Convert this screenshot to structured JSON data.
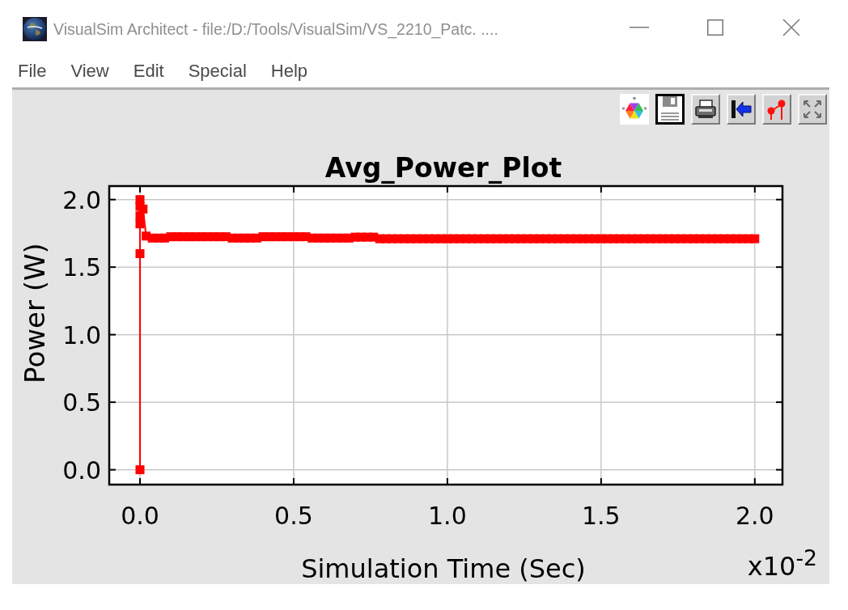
{
  "window": {
    "title": "VisualSim Architect - file:/D:/Tools/VisualSim/VS_2210_Patc. ...."
  },
  "menu": [
    "File",
    "View",
    "Edit",
    "Special",
    "Help"
  ],
  "plot": {
    "chart_data": {
      "type": "line",
      "title": "Avg_Power_Plot",
      "xlabel": "Simulation Time (Sec)",
      "ylabel": "Power (W)",
      "x": [
        0,
        0,
        0,
        0,
        0,
        0,
        0.01,
        0.02,
        0.04,
        0.06,
        0.08,
        0.1,
        0.12,
        0.14,
        0.16,
        0.18,
        0.2,
        0.22,
        0.24,
        0.26,
        0.28,
        0.3,
        0.32,
        0.34,
        0.36,
        0.38,
        0.4,
        0.42,
        0.44,
        0.46,
        0.48,
        0.5,
        0.52,
        0.54,
        0.56,
        0.58,
        0.6,
        0.62,
        0.64,
        0.66,
        0.68,
        0.7,
        0.72,
        0.74,
        0.76,
        0.78,
        0.8,
        0.82,
        0.84,
        0.86,
        0.88,
        0.9,
        0.92,
        0.94,
        0.96,
        0.98,
        1.0,
        1.02,
        1.04,
        1.06,
        1.08,
        1.1,
        1.12,
        1.14,
        1.16,
        1.18,
        1.2,
        1.22,
        1.24,
        1.26,
        1.28,
        1.3,
        1.32,
        1.34,
        1.36,
        1.38,
        1.4,
        1.42,
        1.44,
        1.46,
        1.48,
        1.5,
        1.52,
        1.54,
        1.56,
        1.58,
        1.6,
        1.62,
        1.64,
        1.66,
        1.68,
        1.7,
        1.72,
        1.74,
        1.76,
        1.78,
        1.8,
        1.82,
        1.84,
        1.86,
        1.88,
        1.9,
        1.92,
        1.94,
        1.96,
        1.98,
        2.0
      ],
      "series": [
        {
          "color": "#ff0000",
          "marker": "square",
          "values": [
            0,
            1.6,
            2.0,
            1.95,
            1.88,
            1.82,
            1.93,
            1.73,
            1.715,
            1.715,
            1.715,
            1.725,
            1.725,
            1.725,
            1.725,
            1.725,
            1.725,
            1.725,
            1.725,
            1.725,
            1.725,
            1.715,
            1.715,
            1.715,
            1.715,
            1.715,
            1.725,
            1.725,
            1.725,
            1.725,
            1.725,
            1.725,
            1.725,
            1.725,
            1.715,
            1.715,
            1.715,
            1.715,
            1.715,
            1.715,
            1.715,
            1.722,
            1.722,
            1.722,
            1.722,
            1.71,
            1.71,
            1.71,
            1.71,
            1.71,
            1.71,
            1.71,
            1.71,
            1.71,
            1.71,
            1.71,
            1.71,
            1.71,
            1.71,
            1.71,
            1.71,
            1.71,
            1.71,
            1.71,
            1.71,
            1.71,
            1.71,
            1.71,
            1.71,
            1.71,
            1.71,
            1.71,
            1.71,
            1.71,
            1.71,
            1.71,
            1.71,
            1.71,
            1.71,
            1.71,
            1.71,
            1.71,
            1.71,
            1.71,
            1.71,
            1.71,
            1.71,
            1.71,
            1.71,
            1.71,
            1.71,
            1.71,
            1.71,
            1.71,
            1.71,
            1.71,
            1.71,
            1.71,
            1.71,
            1.71,
            1.71,
            1.71,
            1.71,
            1.71,
            1.71,
            1.71,
            1.71
          ]
        }
      ],
      "xlim": [
        -0.1,
        2.09
      ],
      "ylim": [
        -0.11,
        2.1
      ],
      "xticks": [
        {
          "value": 0,
          "label": "0.0"
        },
        {
          "value": 0.5,
          "label": "0.5"
        },
        {
          "value": 1,
          "label": "1.0"
        },
        {
          "value": 1.5,
          "label": "1.5"
        },
        {
          "value": 2,
          "label": "2.0"
        }
      ],
      "yticks": [
        {
          "value": 0,
          "label": "0.0"
        },
        {
          "value": 0.5,
          "label": "0.5"
        },
        {
          "value": 1,
          "label": "1.0"
        },
        {
          "value": 1.5,
          "label": "1.5"
        },
        {
          "value": 2,
          "label": "2.0"
        }
      ],
      "grid": true
    },
    "axis_multiplier": "x10$^{-2}$"
  }
}
